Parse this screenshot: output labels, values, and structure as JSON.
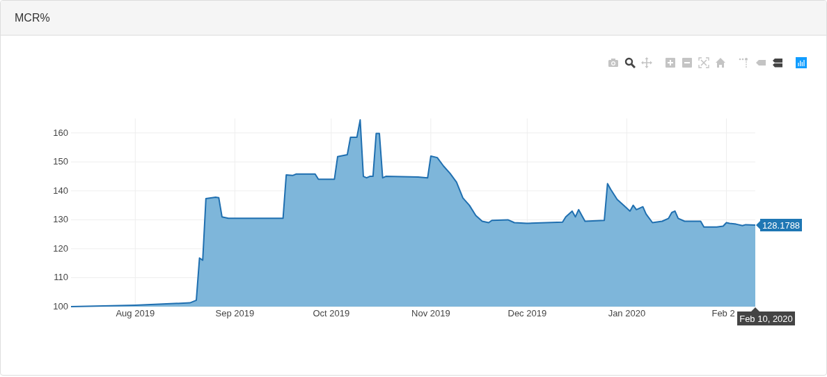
{
  "panel": {
    "title": "MCR%"
  },
  "modebar": [
    {
      "kind": "camera",
      "selected": false
    },
    {
      "kind": "zoom",
      "selected": true
    },
    {
      "kind": "pan",
      "selected": false
    },
    {
      "kind": "zoom-in",
      "selected": false
    },
    {
      "kind": "zoom-out",
      "selected": false
    },
    {
      "kind": "autoscale",
      "selected": false
    },
    {
      "kind": "home",
      "selected": false
    },
    {
      "kind": "spikes",
      "selected": false
    },
    {
      "kind": "hover-closest",
      "selected": false
    },
    {
      "kind": "hover-compare",
      "selected": true
    },
    {
      "kind": "logo"
    }
  ],
  "chart": {
    "chart_data": {
      "type": "area",
      "x": [
        "2019-07-12",
        "2019-08-01",
        "2019-08-18",
        "2019-08-20",
        "2019-08-21",
        "2019-08-22",
        "2019-08-23",
        "2019-08-26",
        "2019-08-27",
        "2019-08-28",
        "2019-08-30",
        "2019-09-16",
        "2019-09-17",
        "2019-09-19",
        "2019-09-20",
        "2019-09-26",
        "2019-09-27",
        "2019-10-02",
        "2019-10-03",
        "2019-10-06",
        "2019-10-07",
        "2019-10-09",
        "2019-10-10",
        "2019-10-11",
        "2019-10-12",
        "2019-10-13",
        "2019-10-14",
        "2019-10-15",
        "2019-10-16",
        "2019-10-17",
        "2019-10-18",
        "2019-10-28",
        "2019-10-31",
        "2019-11-01",
        "2019-11-03",
        "2019-11-05",
        "2019-11-07",
        "2019-11-09",
        "2019-11-11",
        "2019-11-13",
        "2019-11-15",
        "2019-11-17",
        "2019-11-19",
        "2019-11-20",
        "2019-11-25",
        "2019-11-27",
        "2019-12-01",
        "2019-12-12",
        "2019-12-13",
        "2019-12-15",
        "2019-12-16",
        "2019-12-17",
        "2019-12-18",
        "2019-12-19",
        "2019-12-25",
        "2019-12-26",
        "2019-12-27",
        "2019-12-29",
        "2019-12-31",
        "2020-01-02",
        "2020-01-03",
        "2020-01-04",
        "2020-01-06",
        "2020-01-07",
        "2020-01-09",
        "2020-01-12",
        "2020-01-14",
        "2020-01-15",
        "2020-01-16",
        "2020-01-17",
        "2020-01-19",
        "2020-01-24",
        "2020-01-25",
        "2020-01-29",
        "2020-01-31",
        "2020-02-01",
        "2020-02-02",
        "2020-02-04",
        "2020-02-06",
        "2020-02-07",
        "2020-02-10"
      ],
      "series": [
        {
          "color": "#1f6fb0",
          "values": [
            100,
            100.5,
            101.3,
            102.2,
            116.8,
            116,
            137.3,
            137.8,
            137.6,
            131,
            130.5,
            130.5,
            145.5,
            145.3,
            145.8,
            145.8,
            144,
            144,
            151.8,
            152.5,
            158.5,
            158.5,
            164.5,
            145,
            144.5,
            145,
            145,
            159.8,
            159.8,
            144.5,
            145,
            144.8,
            144.5,
            152,
            151.5,
            148.5,
            146,
            143,
            137.5,
            135,
            131.5,
            129.5,
            129,
            129.8,
            130,
            129,
            128.8,
            129.2,
            131,
            133,
            131,
            133.5,
            131.5,
            129.5,
            129.8,
            142.5,
            140.5,
            137,
            135,
            133,
            135,
            133.5,
            134.5,
            132,
            129,
            129.5,
            130.5,
            132.5,
            133,
            130.5,
            129.5,
            129.5,
            127.5,
            127.5,
            127.8,
            129,
            128.8,
            128.5,
            128,
            128.3,
            128.1788
          ]
        }
      ],
      "xlim": [
        "2019-07-12",
        "2020-02-10"
      ],
      "ylim": [
        100,
        165
      ],
      "xticks": [
        {
          "value": "2019-08-01",
          "label": "Aug 2019"
        },
        {
          "value": "2019-09-01",
          "label": "Sep 2019"
        },
        {
          "value": "2019-10-01",
          "label": "Oct 2019"
        },
        {
          "value": "2019-11-01",
          "label": "Nov 2019"
        },
        {
          "value": "2019-12-01",
          "label": "Dec 2019"
        },
        {
          "value": "2020-01-01",
          "label": "Jan 2020"
        }
      ],
      "yticks": [
        100,
        110,
        120,
        130,
        140,
        150,
        160
      ],
      "grid": true
    },
    "cut_tick_label": "Feb 2",
    "hover": {
      "y_label": "128.1788",
      "x_label": "Feb 10, 2020"
    }
  }
}
